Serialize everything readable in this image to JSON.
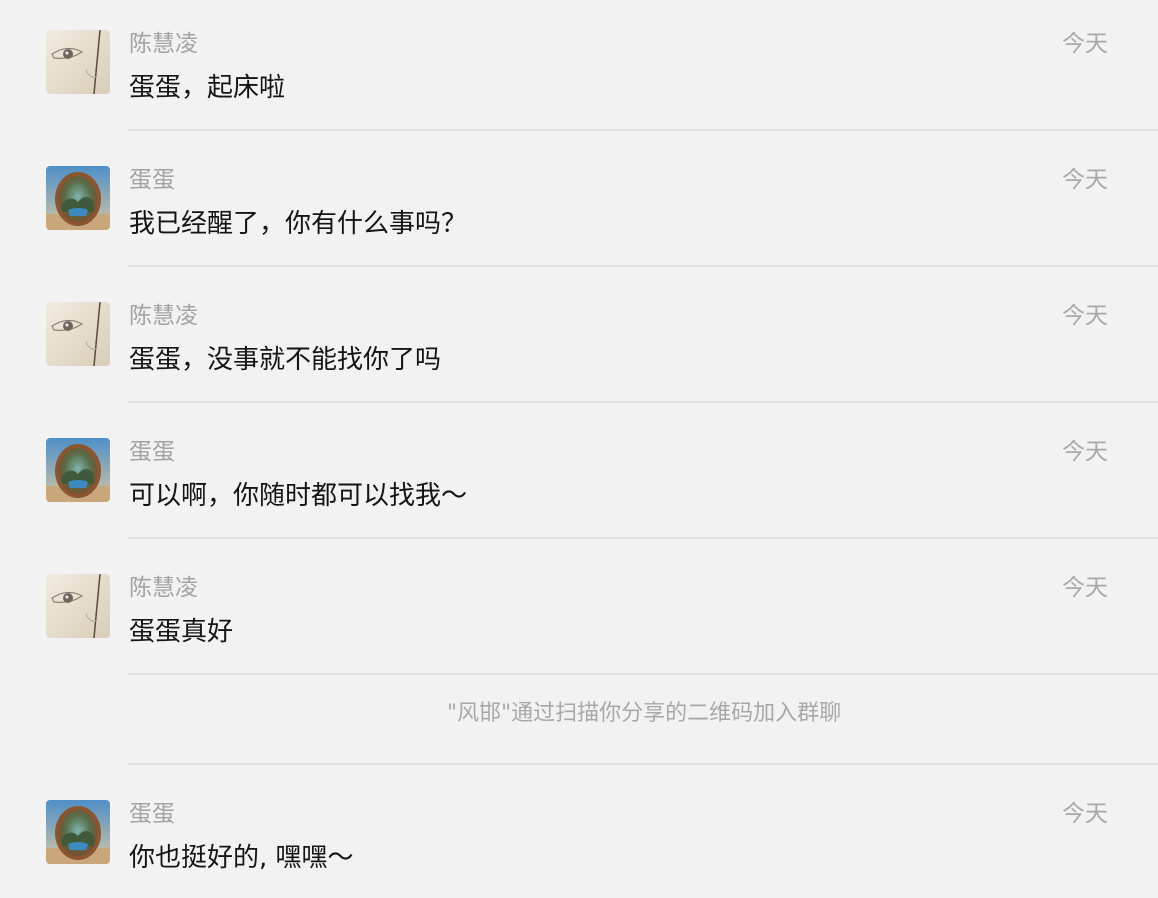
{
  "senders": {
    "chl": "陈慧凌",
    "dd": "蛋蛋"
  },
  "messages": [
    {
      "sender": "陈慧凌",
      "avatar": "sketch-avatar",
      "time": "今天",
      "text": "蛋蛋，起床啦"
    },
    {
      "sender": "蛋蛋",
      "avatar": "egg-landscape-avatar",
      "time": "今天",
      "text": "我已经醒了，你有什么事吗？"
    },
    {
      "sender": "陈慧凌",
      "avatar": "sketch-avatar",
      "time": "今天",
      "text": "蛋蛋，没事就不能找你了吗"
    },
    {
      "sender": "蛋蛋",
      "avatar": "egg-landscape-avatar",
      "time": "今天",
      "text": "可以啊，你随时都可以找我～"
    },
    {
      "sender": "陈慧凌",
      "avatar": "sketch-avatar",
      "time": "今天",
      "text": "蛋蛋真好"
    },
    {
      "sender": "蛋蛋",
      "avatar": "egg-landscape-avatar",
      "time": "今天",
      "text": "你也挺好的, 嘿嘿～"
    }
  ],
  "system_notice": "\"风邯\"通过扫描你分享的二维码加入群聊"
}
